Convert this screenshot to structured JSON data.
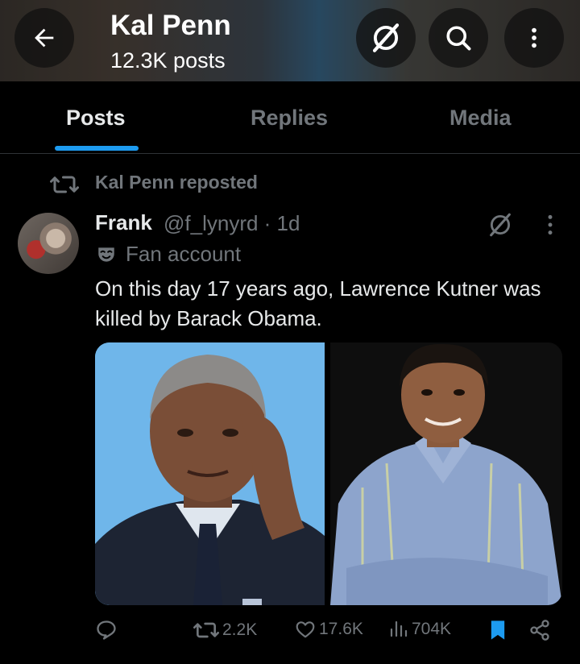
{
  "header": {
    "title": "Kal Penn",
    "subtitle": "12.3K posts"
  },
  "tabs": [
    {
      "label": "Posts",
      "active": true
    },
    {
      "label": "Replies",
      "active": false
    },
    {
      "label": "Media",
      "active": false
    }
  ],
  "repost": {
    "text": "Kal Penn reposted"
  },
  "tweet": {
    "author_name": "Frank",
    "handle_time": "@f_lynyrd · 1d",
    "badge_text": "Fan account",
    "text": "On this day 17 years ago, Lawrence Kutner was killed by Barack Obama.",
    "media": [
      "photo-obama",
      "photo-kal-penn"
    ]
  },
  "actions": {
    "replies": "",
    "reposts": "2.2K",
    "likes": "17.6K",
    "views": "704K"
  },
  "colors": {
    "background": "#000000",
    "text": "#e7e9ea",
    "muted": "#71767b",
    "accent": "#1d9bf0",
    "divider": "#2f3336"
  },
  "icons": [
    "back-arrow-icon",
    "grok-icon",
    "search-icon",
    "more-vertical-icon",
    "repost-icon",
    "theater-mask-icon",
    "reply-icon",
    "heart-icon",
    "views-icon",
    "bookmark-icon",
    "share-icon"
  ]
}
